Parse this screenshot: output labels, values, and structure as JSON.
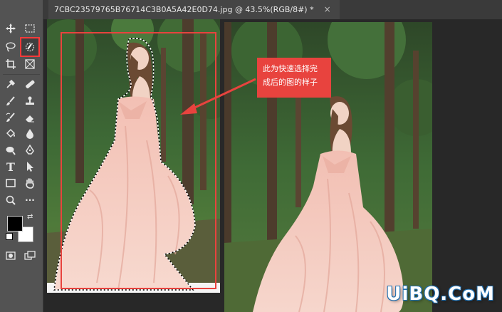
{
  "document": {
    "tab_title": "7CBC23579765B76714C3B0A5A42E0D74.jpg @ 43.5%(RGB/8#) *",
    "close_glyph": "×"
  },
  "annotation": {
    "callout_text": "此为快速选择完成后的图的样子",
    "callout_line1": "此为快速选择完",
    "callout_line2": "成后的图的样子"
  },
  "watermark": {
    "text": "UiBQ.CoM"
  },
  "toolbar": {
    "tools": [
      {
        "name": "move-tool",
        "icon": "move-icon"
      },
      {
        "name": "marquee-tool",
        "icon": "rect-marquee-icon"
      },
      {
        "name": "lasso-tool",
        "icon": "lasso-icon"
      },
      {
        "name": "quick-selection-tool",
        "icon": "quick-selection-brush-icon",
        "selected": true
      },
      {
        "name": "crop-tool",
        "icon": "crop-icon"
      },
      {
        "name": "frame-tool",
        "icon": "frame-icon"
      },
      {
        "name": "eyedropper-tool",
        "icon": "eyedropper-icon"
      },
      {
        "name": "healing-brush-tool",
        "icon": "bandage-icon"
      },
      {
        "name": "brush-tool",
        "icon": "brush-icon"
      },
      {
        "name": "clone-stamp-tool",
        "icon": "stamp-icon"
      },
      {
        "name": "history-brush-tool",
        "icon": "history-brush-icon"
      },
      {
        "name": "eraser-tool",
        "icon": "eraser-icon"
      },
      {
        "name": "paint-bucket-tool",
        "icon": "bucket-icon"
      },
      {
        "name": "blur-tool",
        "icon": "drop-icon"
      },
      {
        "name": "dodge-tool",
        "icon": "dodge-icon"
      },
      {
        "name": "pen-tool",
        "icon": "pen-icon"
      },
      {
        "name": "type-tool",
        "icon": "type-icon",
        "glyph": "T"
      },
      {
        "name": "path-selection-tool",
        "icon": "arrow-icon"
      },
      {
        "name": "rectangle-tool",
        "icon": "rectangle-icon"
      },
      {
        "name": "hand-tool",
        "icon": "hand-icon"
      },
      {
        "name": "zoom-tool",
        "icon": "zoom-icon"
      },
      {
        "name": "more-tools",
        "icon": "more-icon",
        "glyph": "···"
      }
    ]
  },
  "colors": {
    "accent_red": "#e8433e",
    "foreground": "#000000",
    "background": "#ffffff"
  }
}
